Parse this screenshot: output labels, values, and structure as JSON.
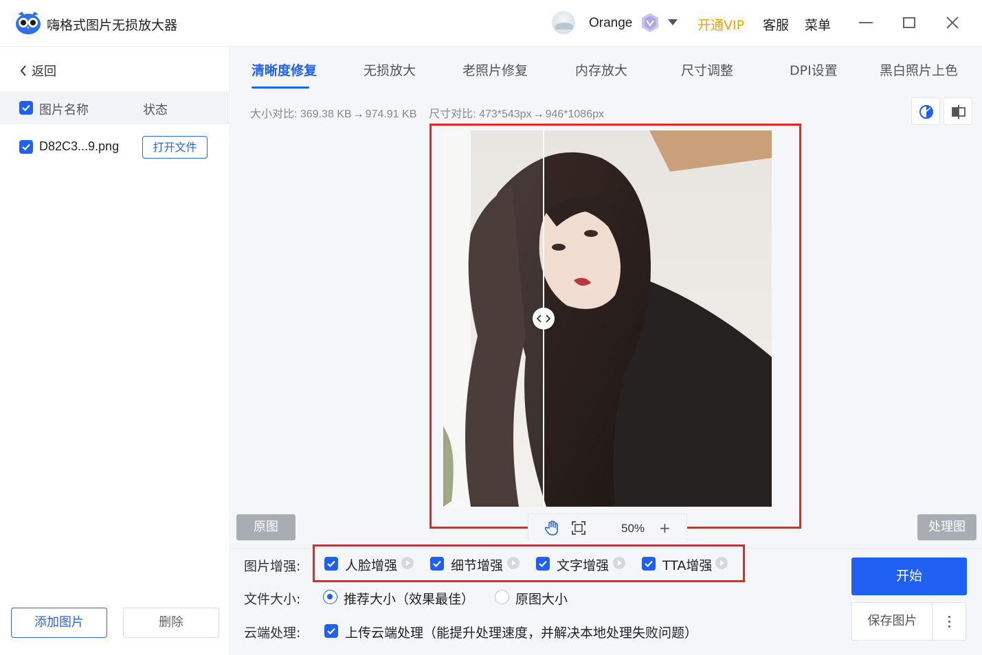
{
  "app": {
    "title": "嗨格式图片无损放大器"
  },
  "header": {
    "user_name": "Orange",
    "vip_label": "开通VIP",
    "service_label": "客服",
    "menu_label": "菜单"
  },
  "sidebar": {
    "back_label": "返回",
    "col_name": "图片名称",
    "col_status": "状态",
    "files": [
      {
        "name": "D82C3...9.png",
        "action": "打开文件"
      }
    ],
    "add_label": "添加图片",
    "delete_label": "删除"
  },
  "tabs": [
    {
      "label": "清晰度修复",
      "active": true
    },
    {
      "label": "无损放大",
      "active": false
    },
    {
      "label": "老照片修复",
      "active": false
    },
    {
      "label": "内存放大",
      "active": false
    },
    {
      "label": "尺寸调整",
      "active": false
    },
    {
      "label": "DPI设置",
      "active": false
    },
    {
      "label": "黑白照片上色",
      "active": false
    }
  ],
  "info": {
    "size_label": "大小对比:",
    "size_from": "369.38 KB",
    "size_to": "974.91 KB",
    "dim_label": "尺寸对比:",
    "dim_from": "473*543px",
    "dim_to": "946*1086px"
  },
  "preview": {
    "original_label": "原图",
    "processed_label": "处理图",
    "zoom": "50%",
    "zoom_plus": "+"
  },
  "options": {
    "enhance_label": "图片增强:",
    "enhance_items": [
      {
        "label": "人脸增强",
        "checked": true
      },
      {
        "label": "细节增强",
        "checked": true
      },
      {
        "label": "文字增强",
        "checked": true
      },
      {
        "label": "TTA增强",
        "checked": true
      }
    ],
    "size_label": "文件大小:",
    "size_options": [
      {
        "label": "推荐大小（效果最佳）",
        "selected": true
      },
      {
        "label": "原图大小",
        "selected": false
      }
    ],
    "cloud_label": "云端处理:",
    "cloud_option": "上传云端处理（能提升处理速度，并解决本地处理失败问题）"
  },
  "actions": {
    "start_label": "开始",
    "save_label": "保存图片"
  },
  "colors": {
    "accent": "#1f5ff2",
    "vip": "#f3a012",
    "highlight": "#ee2222"
  }
}
